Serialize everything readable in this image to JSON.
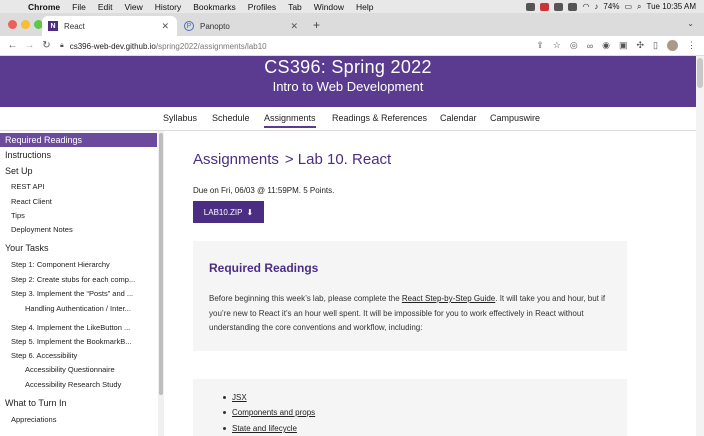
{
  "menubar": {
    "app": "Chrome",
    "items": [
      "File",
      "Edit",
      "View",
      "History",
      "Bookmarks",
      "Profiles",
      "Tab",
      "Window",
      "Help"
    ],
    "battery": "74%",
    "clock": "Tue 10:35 AM"
  },
  "tabs": [
    {
      "title": "React",
      "favicon": "N"
    },
    {
      "title": "Panopto",
      "favicon": "P"
    }
  ],
  "address": {
    "host": "cs396-web-dev.github.io",
    "path": "/spring2022/assignments/lab10"
  },
  "hero": {
    "title": "CS396: Spring 2022",
    "subtitle": "Intro to Web Development",
    "color": "#5b3b8f"
  },
  "topnav": [
    "Syllabus",
    "Schedule",
    "Assignments",
    "Readings & References",
    "Calendar",
    "Campuswire"
  ],
  "sidebar": [
    {
      "label": "Required Readings",
      "level": 1,
      "active": true
    },
    {
      "label": "Instructions",
      "level": 1
    },
    {
      "label": "Set Up",
      "level": 1
    },
    {
      "label": "REST API",
      "level": 2
    },
    {
      "label": "React Client",
      "level": 2
    },
    {
      "label": "Tips",
      "level": 2
    },
    {
      "label": "Deployment Notes",
      "level": 2
    },
    {
      "label": "Your Tasks",
      "level": 1
    },
    {
      "label": "Step 1: Component Hierarchy",
      "level": 2
    },
    {
      "label": "Step 2: Create stubs for each comp...",
      "level": 2
    },
    {
      "label": "Step 3. Implement the “Posts” and ...",
      "level": 2
    },
    {
      "label": "Handling Authentication / Inter...",
      "level": 3
    },
    {
      "label": "Step 4. Implement the LikeButton ...",
      "level": 2
    },
    {
      "label": "Step 5. Implement the BookmarkB...",
      "level": 2
    },
    {
      "label": "Step 6. Accessibility",
      "level": 2
    },
    {
      "label": "Accessibility Questionnaire",
      "level": 3
    },
    {
      "label": "Accessibility Research Study",
      "level": 3
    },
    {
      "label": "What to Turn In",
      "level": 1
    },
    {
      "label": "Appreciations",
      "level": 2
    }
  ],
  "main": {
    "heading": "Assignments",
    "crumb": "> Lab 10. React",
    "due": "Due on Fri, 06/03 @ 11:59PM. 5 Points.",
    "download_label": "LAB10.ZIP",
    "section_title": "Required Readings",
    "para_before": "Before beginning this week’s lab, please complete the ",
    "para_link": "React Step-by-Step Guide",
    "para_after": ". It will take you and hour, but if you’re new to React it’s an hour well spent. It will be impossible for you to work effectively in React without understanding the core conventions and workflow, including:",
    "list": [
      "JSX",
      "Components and props",
      "State and lifecycle"
    ]
  }
}
